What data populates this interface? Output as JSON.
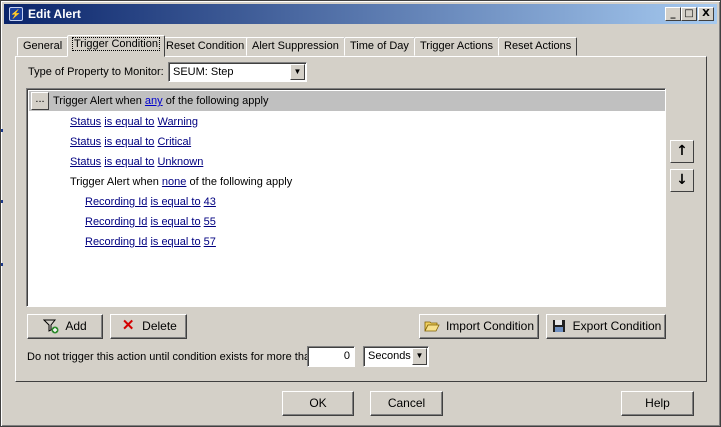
{
  "window": {
    "title": "Edit Alert",
    "controls": {
      "minimize": "_",
      "maximize": "□",
      "close": "X"
    }
  },
  "tabs": [
    {
      "label": "General",
      "active": false
    },
    {
      "label": "Trigger Condition",
      "active": true
    },
    {
      "label": "Reset Condition",
      "active": false
    },
    {
      "label": "Alert Suppression",
      "active": false
    },
    {
      "label": "Time of Day",
      "active": false
    },
    {
      "label": "Trigger Actions",
      "active": false
    },
    {
      "label": "Reset Actions",
      "active": false
    }
  ],
  "property": {
    "label": "Type of Property to Monitor:",
    "value": "SEUM: Step"
  },
  "tree": {
    "root": {
      "button": "...",
      "prefix": "Trigger Alert when",
      "quantifier": "any",
      "suffix": "of the following apply"
    },
    "conditions": [
      {
        "field": "Status",
        "op": "is equal to",
        "value": "Warning"
      },
      {
        "field": "Status",
        "op": "is equal to",
        "value": "Critical"
      },
      {
        "field": "Status",
        "op": "is equal to",
        "value": "Unknown"
      }
    ],
    "group": {
      "prefix": "Trigger Alert when",
      "quantifier": "none",
      "suffix": "of the following apply"
    },
    "group_conditions": [
      {
        "field": "Recording Id",
        "op": "is equal to",
        "value": "43"
      },
      {
        "field": "Recording Id",
        "op": "is equal to",
        "value": "55"
      },
      {
        "field": "Recording Id",
        "op": "is equal to",
        "value": "57"
      }
    ]
  },
  "side_buttons": {
    "up": "↑",
    "down": "↓"
  },
  "actions": {
    "add": "Add",
    "delete": "Delete",
    "import": "Import Condition",
    "export": "Export Condition"
  },
  "delay": {
    "label": "Do not trigger this action until condition exists for more than",
    "value": "0",
    "unit": "Seconds"
  },
  "footer": {
    "ok": "OK",
    "cancel": "Cancel",
    "help": "Help"
  },
  "colors": {
    "link": "#0000cc",
    "title_start": "#0a246a",
    "title_end": "#a6caf0",
    "face": "#d4d0c8"
  }
}
